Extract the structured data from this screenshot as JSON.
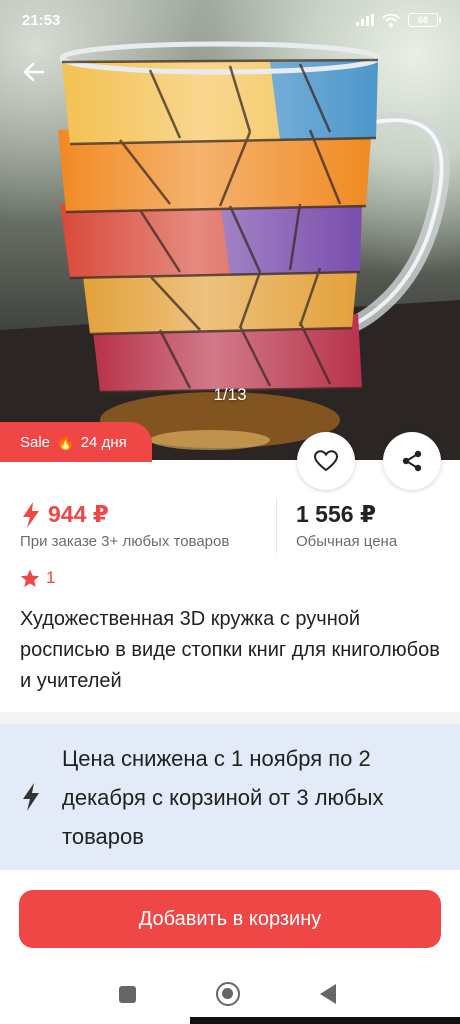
{
  "status_bar": {
    "time": "21:53",
    "battery": "68"
  },
  "gallery": {
    "counter": "1/13"
  },
  "sale_badge": {
    "label": "Sale",
    "fire_icon": "🔥",
    "duration": "24 дня"
  },
  "prices": {
    "sale_price": "944 ₽",
    "sale_note": "При заказе 3+ любых товаров",
    "regular_price": "1 556 ₽",
    "regular_note": "Обычная цена"
  },
  "rating": {
    "count": "1"
  },
  "product": {
    "title": "Художественная 3D кружка с ручной росписью в виде стопки книг для книголюбов и учителей"
  },
  "promo": {
    "text": "Цена снижена с 1 ноября по 2 декабря с корзиной от 3 любых товаров"
  },
  "actions": {
    "add_to_cart": "Добавить в корзину"
  },
  "icons": {
    "back": "arrow-left-icon",
    "favorite": "heart-icon",
    "share": "share-icon",
    "sale_price": "lightning-icon",
    "rating": "star-icon",
    "promo": "lightning-icon"
  },
  "colors": {
    "accent": "#ef4646",
    "promo_bg": "#e3ebf8",
    "text": "#222222",
    "muted": "#6d6d6d"
  }
}
